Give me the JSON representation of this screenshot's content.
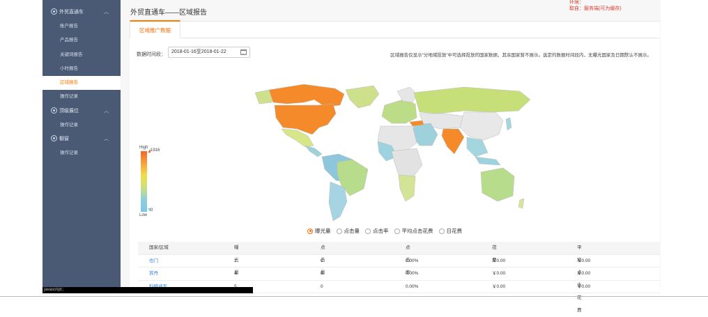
{
  "sidebar": {
    "groups": [
      {
        "label": "外贸直通车",
        "items": [
          "账户报告",
          "产品报告",
          "关键词报告",
          "小时报告",
          "区域报告",
          "操作记录"
        ]
      },
      {
        "label": "顶级展位",
        "items": [
          "操作记录"
        ]
      },
      {
        "label": "橱窗",
        "items": [
          "操作记录"
        ]
      }
    ],
    "active_item": "区域报告"
  },
  "page": {
    "title": "外贸直通车——区域报告",
    "tab": "区域推广数据",
    "date_label": "数据时间段：",
    "date_value": "2018-01-16至2018-01-22",
    "notice": "区域报告仅显示“分地域投放”中可选择投放的国家数据，其余国家暂不展示。选定的数据时间段内，无曝光国家及日期默认不展示。"
  },
  "legend": {
    "high": "High",
    "low": "Low",
    "max": "1916",
    "min": "0",
    "colors": [
      "#f4652a",
      "#f0de4a",
      "#7fc6e8"
    ]
  },
  "metrics": {
    "options": [
      "曝光量",
      "点击量",
      "点击率",
      "平均点击花费",
      "日花费"
    ],
    "selected": "曝光量"
  },
  "table": {
    "headers": [
      "国家/区域",
      "曝光量",
      "点击量",
      "点击率",
      "花费",
      "平均点击花费"
    ],
    "rows": [
      [
        "也门",
        "1",
        "0",
        "0.00%",
        "￥0.00",
        "￥0.00"
      ],
      [
        "苏丹",
        "4",
        "0",
        "0.00%",
        "￥0.00",
        "￥0.00"
      ],
      [
        "科特迪瓦",
        "5",
        "0",
        "0.00%",
        "￥0.00",
        "￥0.00"
      ]
    ]
  },
  "corner_text": {
    "line1": "环境：",
    "line2": "取自：服务端(可为缓存)"
  },
  "console": "javascript:;"
}
